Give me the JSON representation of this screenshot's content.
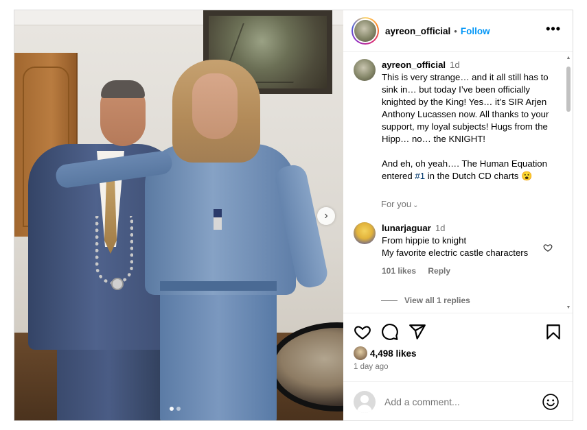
{
  "post": {
    "username": "ayreon_official",
    "follow_label": "Follow",
    "separator": "•",
    "more_label": "•••",
    "carousel_next": "›"
  },
  "caption": {
    "username": "ayreon_official",
    "age": "1d",
    "text_part1": "This is very strange… and it all still has to sink in… but today I’ve been officially knighted by the King! Yes… it’s SIR Arjen Anthony Lucassen now. All thanks to your support, my loyal subjects! Hugs from the Hipp… no… the KNIGHT!\n\nAnd eh, oh yeah…. The Human Equation entered ",
    "hashtag": "#1",
    "text_part2": " in the Dutch CD charts 😮"
  },
  "for_you": {
    "label": "For you",
    "chevron": "⌄"
  },
  "comment": {
    "username": "lunarjaguar",
    "age": "1d",
    "line1": "From hippie to knight",
    "line2": "My favorite electric castle characters",
    "likes": "101 likes",
    "reply_label": "Reply",
    "view_replies": "View all 1 replies"
  },
  "footer": {
    "likes_count": "4,498 likes",
    "time_ago": "1 day ago",
    "comment_placeholder": "Add a comment..."
  },
  "icons": {
    "like": "heart-icon",
    "comment": "comment-icon",
    "share": "share-icon",
    "save": "bookmark-icon",
    "emoji": "emoji-icon",
    "more": "more-icon",
    "next": "chevron-right-icon"
  },
  "colors": {
    "follow": "#0095f6",
    "hashtag": "#00376b",
    "muted": "#737373",
    "border": "#dbdbdb"
  },
  "carousel": {
    "slides": 2,
    "active_slide": 1
  }
}
